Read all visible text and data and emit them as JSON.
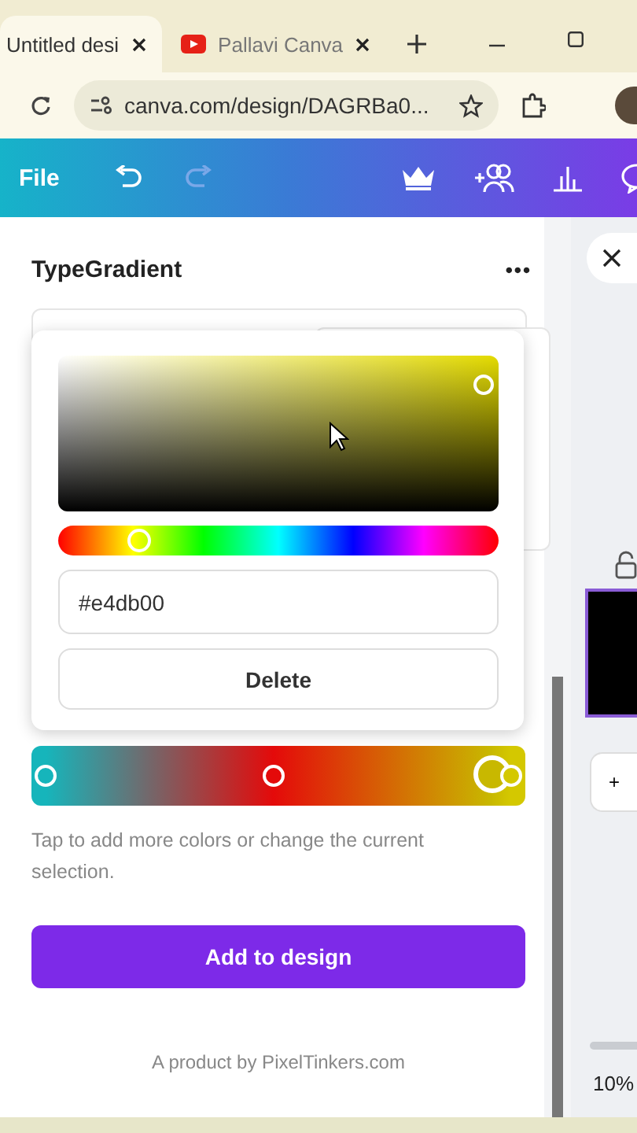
{
  "browser": {
    "tabs": [
      {
        "label": "Untitled desi",
        "selected": true
      },
      {
        "label": "Pallavi Canva",
        "selected": false
      }
    ],
    "address": "canva.com/design/DAGRBa0..."
  },
  "toolbar": {
    "file": "File"
  },
  "panel": {
    "title": "TypeGradient",
    "more": "•••",
    "picker": {
      "hue": {
        "level": 0.18
      },
      "hex": "#e4db00",
      "delete": "Delete"
    },
    "gradient_stops": [
      {
        "color": "#16b5bb",
        "level": 0.03,
        "selected": false
      },
      {
        "color": "#e40a0a",
        "level": 0.49,
        "selected": false
      },
      {
        "color": "#c8b800",
        "level": 0.93,
        "selected": true
      },
      {
        "color": "#d4c800",
        "level": 0.97,
        "selected": false
      }
    ],
    "hint": "Tap to add more colors or change the current selection.",
    "add_button": "Add to design",
    "footer": "A product by PixelTinkers.com"
  },
  "side": {
    "add": "+",
    "zoom": "10%"
  }
}
